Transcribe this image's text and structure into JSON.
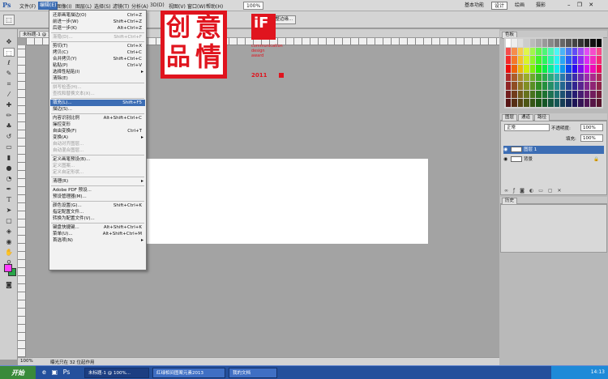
{
  "app": {
    "logo": "Ps"
  },
  "menubar": {
    "items": [
      "文件(F)",
      "编辑(E)",
      "图像(I)",
      "图层(L)",
      "选择(S)",
      "滤镜(T)",
      "分析(A)",
      "3D(D)",
      "视图(V)",
      "窗口(W)",
      "帮助(H)"
    ],
    "active_index": 1,
    "zoom": "100%",
    "workspaces": [
      "基本功能",
      "设计",
      "绘画",
      "摄影"
    ],
    "active_workspace": 1
  },
  "options": {
    "button": "调整边缘..."
  },
  "document": {
    "tab": "未标题-1 @ 100%",
    "zoom": "100%",
    "status": "曝光只在 32 位起作用"
  },
  "edit_menu": [
    {
      "label": "还原画笔描边(O)",
      "shortcut": "Ctrl+Z",
      "disabled": false
    },
    {
      "label": "前进一步(W)",
      "shortcut": "Shift+Ctrl+Z",
      "disabled": false
    },
    {
      "label": "后退一步(K)",
      "shortcut": "Alt+Ctrl+Z",
      "disabled": false
    },
    {
      "sep": true
    },
    {
      "label": "渐隐(D)...",
      "shortcut": "Shift+Ctrl+F",
      "disabled": true
    },
    {
      "sep": true
    },
    {
      "label": "剪切(T)",
      "shortcut": "Ctrl+X",
      "disabled": false
    },
    {
      "label": "拷贝(C)",
      "shortcut": "Ctrl+C",
      "disabled": false
    },
    {
      "label": "合并拷贝(Y)",
      "shortcut": "Shift+Ctrl+C",
      "disabled": false
    },
    {
      "label": "粘贴(P)",
      "shortcut": "Ctrl+V",
      "disabled": false
    },
    {
      "label": "选择性粘贴(I)",
      "shortcut": "",
      "disabled": false,
      "submenu": true
    },
    {
      "label": "清除(E)",
      "shortcut": "",
      "disabled": false
    },
    {
      "sep": true
    },
    {
      "label": "拼写检查(H)...",
      "shortcut": "",
      "disabled": true
    },
    {
      "label": "查找和替换文本(X)...",
      "shortcut": "",
      "disabled": true
    },
    {
      "sep": true
    },
    {
      "label": "填充(L)...",
      "shortcut": "Shift+F5",
      "disabled": false,
      "highlight": true
    },
    {
      "label": "描边(S)...",
      "shortcut": "",
      "disabled": false
    },
    {
      "sep": true
    },
    {
      "label": "内容识别比例",
      "shortcut": "Alt+Shift+Ctrl+C",
      "disabled": false
    },
    {
      "label": "操控变形",
      "shortcut": "",
      "disabled": false
    },
    {
      "label": "自由变换(F)",
      "shortcut": "Ctrl+T",
      "disabled": false
    },
    {
      "label": "变换(A)",
      "shortcut": "",
      "disabled": false,
      "submenu": true
    },
    {
      "label": "自动对齐图层...",
      "shortcut": "",
      "disabled": true
    },
    {
      "label": "自动混合图层...",
      "shortcut": "",
      "disabled": true
    },
    {
      "sep": true
    },
    {
      "label": "定义画笔预设(B)...",
      "shortcut": "",
      "disabled": false
    },
    {
      "label": "定义图案...",
      "shortcut": "",
      "disabled": true
    },
    {
      "label": "定义自定形状...",
      "shortcut": "",
      "disabled": true
    },
    {
      "sep": true
    },
    {
      "label": "清理(R)",
      "shortcut": "",
      "disabled": false,
      "submenu": true
    },
    {
      "sep": true
    },
    {
      "label": "Adobe PDF 预设...",
      "shortcut": "",
      "disabled": false
    },
    {
      "label": "预设管理器(M)...",
      "shortcut": "",
      "disabled": false
    },
    {
      "sep": true
    },
    {
      "label": "颜色设置(G)...",
      "shortcut": "Shift+Ctrl+K",
      "disabled": false
    },
    {
      "label": "指定配置文件...",
      "shortcut": "",
      "disabled": false
    },
    {
      "label": "转换为配置文件(V)...",
      "shortcut": "",
      "disabled": false
    },
    {
      "sep": true
    },
    {
      "label": "键盘快捷键...",
      "shortcut": "Alt+Shift+Ctrl+K",
      "disabled": false
    },
    {
      "label": "菜单(U)...",
      "shortcut": "Alt+Shift+Ctrl+M",
      "disabled": false
    },
    {
      "label": "首选项(N)",
      "shortcut": "",
      "disabled": false,
      "submenu": true
    }
  ],
  "artwork": {
    "seal_glyphs": [
      "创",
      "意",
      "品",
      "情"
    ],
    "if_logo": "iF",
    "if_lines": [
      "communication",
      "design",
      "award"
    ],
    "year": "2011",
    "brand_red": "#e0141e"
  },
  "panels": {
    "color_tabs": [
      "色板"
    ],
    "layers_tabs": [
      "图层",
      "通道",
      "路径"
    ],
    "blend_mode": "正常",
    "opacity_label": "不透明度:",
    "opacity": "100%",
    "fill_label": "填充:",
    "fill": "100%",
    "layers": [
      {
        "name": "图层 1",
        "selected": true
      },
      {
        "name": "背景",
        "selected": false
      }
    ],
    "history_tab": "历史"
  },
  "taskbar": {
    "start": "开始",
    "tasks": [
      "未标题-1 @ 100%...",
      "红绿相间图案元素2013",
      "我的文档"
    ],
    "active_task": 0,
    "clock": "14:13"
  },
  "colors": {
    "foreground": "#ff40ff",
    "background": "#2aa54a",
    "accent": "#3c6db4"
  }
}
